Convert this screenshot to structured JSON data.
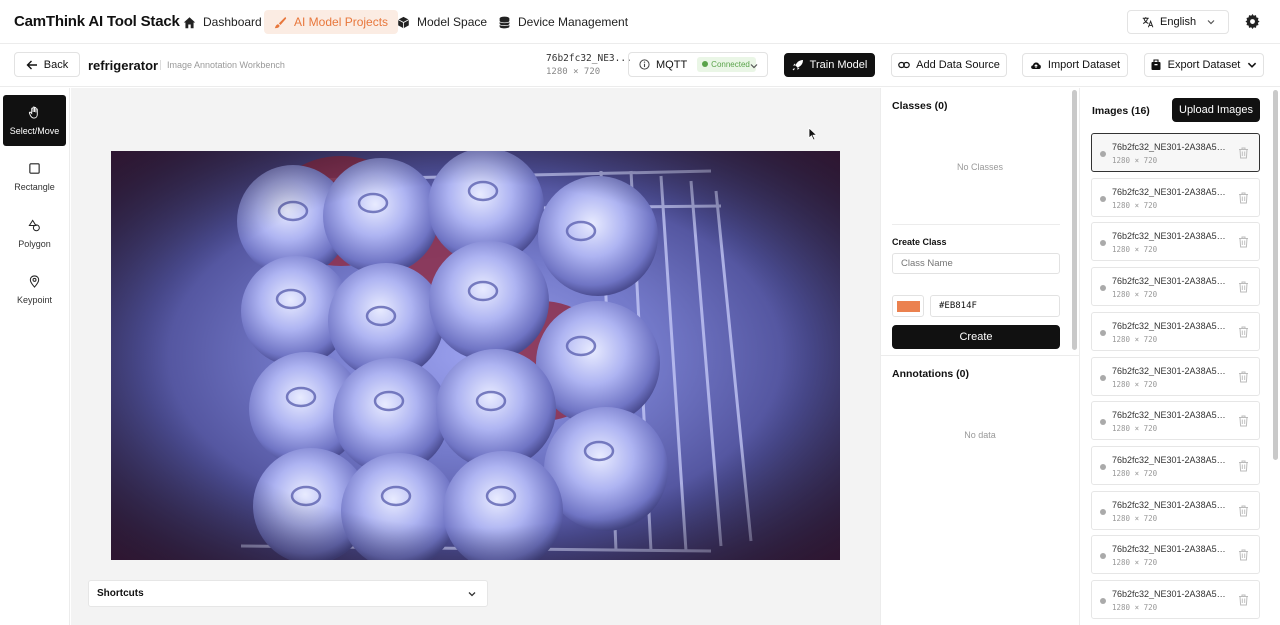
{
  "app": {
    "title": "CamThink AI Tool Stack"
  },
  "nav": [
    {
      "label": "Dashboard",
      "icon": "home-icon"
    },
    {
      "label": "AI Model Projects",
      "icon": "brush-icon"
    },
    {
      "label": "Model Space",
      "icon": "cube-icon"
    },
    {
      "label": "Device Management",
      "icon": "database-icon"
    }
  ],
  "language": "English",
  "toolbar": {
    "back": "Back",
    "project": "refrigerator",
    "subtitle": "Image Annotation Workbench",
    "image_name": "76b2fc32_NE3...",
    "image_size": "1280 × 720",
    "mqtt_label": "MQTT",
    "mqtt_status": "Connected",
    "train": "Train Model",
    "add_source": "Add Data Source",
    "import": "Import Dataset",
    "export": "Export Dataset"
  },
  "tools": [
    {
      "label": "Select/Move",
      "icon": "hand-icon"
    },
    {
      "label": "Rectangle",
      "icon": "square-icon"
    },
    {
      "label": "Polygon",
      "icon": "shapes-icon"
    },
    {
      "label": "Keypoint",
      "icon": "pin-icon"
    }
  ],
  "shortcuts": "Shortcuts",
  "classes": {
    "title": "Classes (0)",
    "empty": "No Classes",
    "create_title": "Create Class",
    "placeholder": "Class Name",
    "color": "#EB814F",
    "create_button": "Create"
  },
  "annotations": {
    "title": "Annotations (0)",
    "empty": "No data"
  },
  "images": {
    "title": "Images (16)",
    "upload": "Upload Images",
    "items": [
      {
        "name": "76b2fc32_NE301-2A38A5_...",
        "size": "1280 × 720"
      },
      {
        "name": "76b2fc32_NE301-2A38A5_...",
        "size": "1280 × 720"
      },
      {
        "name": "76b2fc32_NE301-2A38A5_...",
        "size": "1280 × 720"
      },
      {
        "name": "76b2fc32_NE301-2A38A5_...",
        "size": "1280 × 720"
      },
      {
        "name": "76b2fc32_NE301-2A38A5_...",
        "size": "1280 × 720"
      },
      {
        "name": "76b2fc32_NE301-2A38A5_...",
        "size": "1280 × 720"
      },
      {
        "name": "76b2fc32_NE301-2A38A5_...",
        "size": "1280 × 720"
      },
      {
        "name": "76b2fc32_NE301-2A38A5_...",
        "size": "1280 × 720"
      },
      {
        "name": "76b2fc32_NE301-2A38A5_...",
        "size": "1280 × 720"
      },
      {
        "name": "76b2fc32_NE301-2A38A5_...",
        "size": "1280 × 720"
      },
      {
        "name": "76b2fc32_NE301-2A38A5_...",
        "size": "1280 × 720"
      }
    ]
  }
}
